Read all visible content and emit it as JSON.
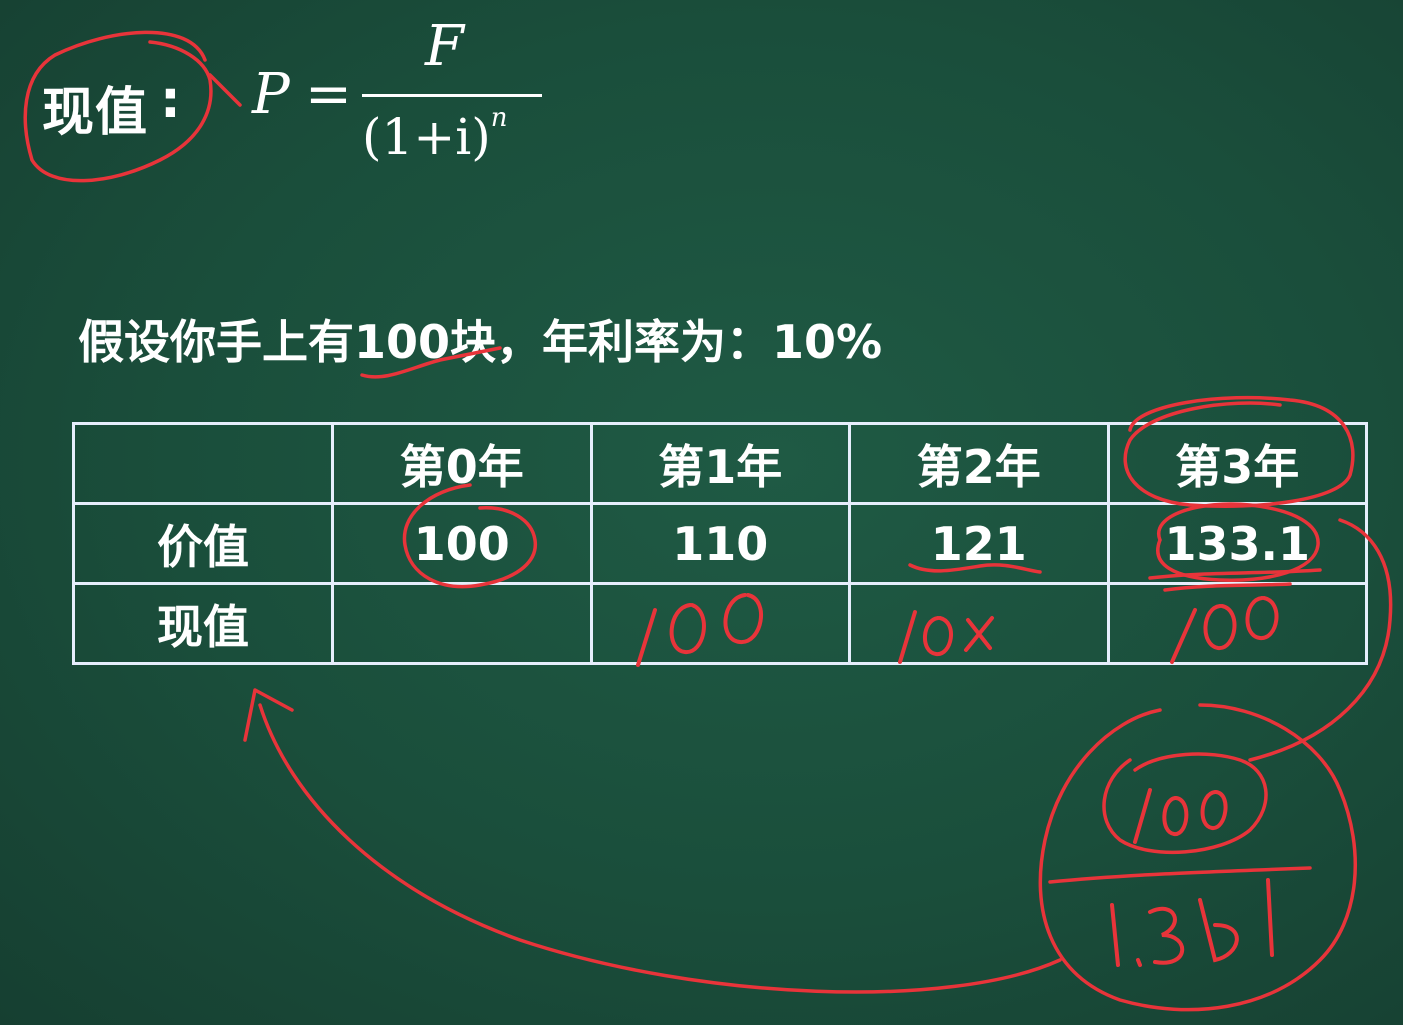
{
  "formula": {
    "term": "现值",
    "colon": ":",
    "lhs": "P",
    "equals": "=",
    "numerator": "F",
    "denominator": "(1+i)",
    "exponent": "n"
  },
  "premise": "假设你手上有100块，年利率为：10%",
  "table": {
    "headers": [
      "",
      "第0年",
      "第1年",
      "第2年",
      "第3年"
    ],
    "rows": [
      {
        "label": "价值",
        "cells": [
          "100",
          "110",
          "121",
          "133.1"
        ]
      },
      {
        "label": "现值",
        "cells": [
          "",
          "",
          "",
          ""
        ]
      }
    ]
  },
  "annotations": {
    "handwritten_present_values": [
      "100",
      "100",
      "100"
    ],
    "handwritten_fraction_numerator": "100",
    "handwritten_fraction_denominator": "1.331",
    "ink_color": "#e8343a"
  }
}
